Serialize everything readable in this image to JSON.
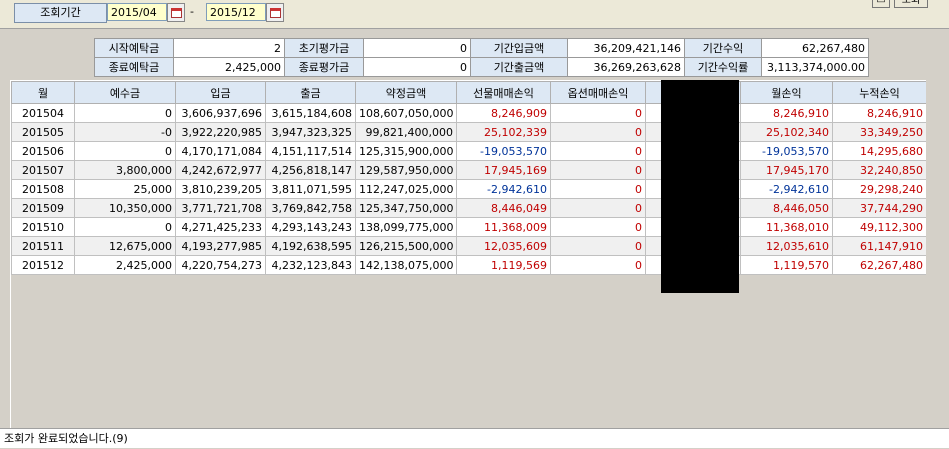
{
  "query": {
    "period_label": "조회기간",
    "start_date": "2015/04",
    "end_date": "2015/12",
    "separator": "-",
    "search_button": "조회",
    "calendar_icon": "calendar-icon"
  },
  "summary": {
    "rows": [
      [
        "시작예탁금",
        "2",
        "초기평가금",
        "0",
        "기간입금액",
        "36,209,421,146",
        "기간수익",
        "62,267,480"
      ],
      [
        "종료예탁금",
        "2,425,000",
        "종료평가금",
        "0",
        "기간출금액",
        "36,269,263,628",
        "기간수익률",
        "3,113,374,000.00"
      ]
    ]
  },
  "table": {
    "headers": [
      "월",
      "예수금",
      "입금",
      "출금",
      "약정금액",
      "선물매매손익",
      "옵션매매손익",
      "",
      "월손익",
      "누적손익"
    ],
    "rows": [
      [
        "201504",
        "0",
        "3,606,937,696",
        "3,615,184,608",
        "108,607,050,000",
        "8,246,909",
        "0",
        "",
        "8,246,910",
        "8,246,910"
      ],
      [
        "201505",
        "-0",
        "3,922,220,985",
        "3,947,323,325",
        "99,821,400,000",
        "25,102,339",
        "0",
        "",
        "25,102,340",
        "33,349,250"
      ],
      [
        "201506",
        "0",
        "4,170,171,084",
        "4,151,117,514",
        "125,315,900,000",
        "-19,053,570",
        "0",
        "",
        "-19,053,570",
        "14,295,680"
      ],
      [
        "201507",
        "3,800,000",
        "4,242,672,977",
        "4,256,818,147",
        "129,587,950,000",
        "17,945,169",
        "0",
        "",
        "17,945,170",
        "32,240,850"
      ],
      [
        "201508",
        "25,000",
        "3,810,239,205",
        "3,811,071,595",
        "112,247,025,000",
        "-2,942,610",
        "0",
        "",
        "-2,942,610",
        "29,298,240"
      ],
      [
        "201509",
        "10,350,000",
        "3,771,721,708",
        "3,769,842,758",
        "125,347,750,000",
        "8,446,049",
        "0",
        "",
        "8,446,050",
        "37,744,290"
      ],
      [
        "201510",
        "0",
        "4,271,425,233",
        "4,293,143,243",
        "138,099,775,000",
        "11,368,009",
        "0",
        "",
        "11,368,010",
        "49,112,300"
      ],
      [
        "201511",
        "12,675,000",
        "4,193,277,985",
        "4,192,638,595",
        "126,215,500,000",
        "12,035,609",
        "0",
        "",
        "12,035,610",
        "61,147,910"
      ],
      [
        "201512",
        "2,425,000",
        "4,220,754,273",
        "4,232,123,843",
        "142,138,075,000",
        "1,119,569",
        "0",
        "",
        "1,119,570",
        "62,267,480"
      ]
    ],
    "row_colors": [
      [
        "",
        "",
        "",
        "",
        "",
        "red",
        "red",
        "",
        "red",
        "red"
      ],
      [
        "",
        "",
        "",
        "",
        "",
        "red",
        "red",
        "",
        "red",
        "red"
      ],
      [
        "",
        "",
        "",
        "",
        "",
        "blue",
        "red",
        "",
        "blue",
        "red"
      ],
      [
        "",
        "",
        "",
        "",
        "",
        "red",
        "red",
        "",
        "red",
        "red"
      ],
      [
        "",
        "",
        "",
        "",
        "",
        "blue",
        "red",
        "",
        "blue",
        "red"
      ],
      [
        "",
        "",
        "",
        "",
        "",
        "red",
        "red",
        "",
        "red",
        "red"
      ],
      [
        "",
        "",
        "",
        "",
        "",
        "red",
        "red",
        "",
        "red",
        "red"
      ],
      [
        "",
        "",
        "",
        "",
        "",
        "red",
        "red",
        "",
        "red",
        "red"
      ],
      [
        "",
        "",
        "",
        "",
        "",
        "red",
        "red",
        "",
        "red",
        "red"
      ]
    ]
  },
  "status": {
    "message": "조회가 완료되었습니다.(9)"
  },
  "colors": {
    "profit": "#c00000",
    "loss": "#003399",
    "header_bg": "#dde8f4",
    "input_bg": "#ffffcc"
  }
}
